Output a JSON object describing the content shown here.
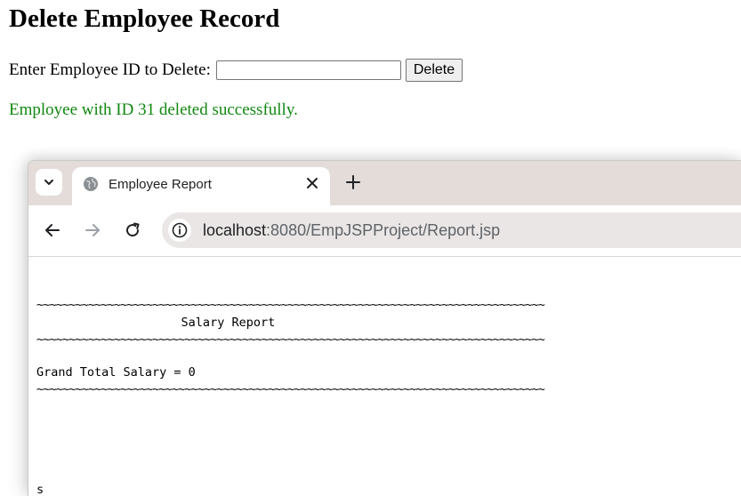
{
  "page": {
    "title": "Delete Employee Record",
    "form_label": "Enter Employee ID to Delete:",
    "input_value": "",
    "delete_label": "Delete",
    "message": "Employee with ID 31 deleted successfully.",
    "message_color": "#118811"
  },
  "browser": {
    "tab_title": "Employee Report",
    "url_host": "localhost",
    "url_rest": ":8080/EmpJSPProject/Report.jsp",
    "icons": [
      "chevron-down-icon",
      "globe-icon",
      "close-icon",
      "plus-icon",
      "back-arrow-icon",
      "forward-arrow-icon",
      "reload-icon",
      "info-icon"
    ]
  },
  "report": {
    "rule1": "~~~~~~~~~~~~~~~~~~~~~~~~~~~~~~~~~~~~~~~~~~~~~~~~~~~~~~~~~~~~~~~~~~~~~~~~~~~~~~~",
    "heading": "                    Salary Report",
    "rule2": "~~~~~~~~~~~~~~~~~~~~~~~~~~~~~~~~~~~~~~~~~~~~~~~~~~~~~~~~~~~~~~~~~~~~~~~~~~~~~~~",
    "total": "Grand Total Salary = 0",
    "rule3": "~~~~~~~~~~~~~~~~~~~~~~~~~~~~~~~~~~~~~~~~~~~~~~~~~~~~~~~~~~~~~~~~~~~~~~~~~~~~~~~",
    "trailing": "s"
  }
}
